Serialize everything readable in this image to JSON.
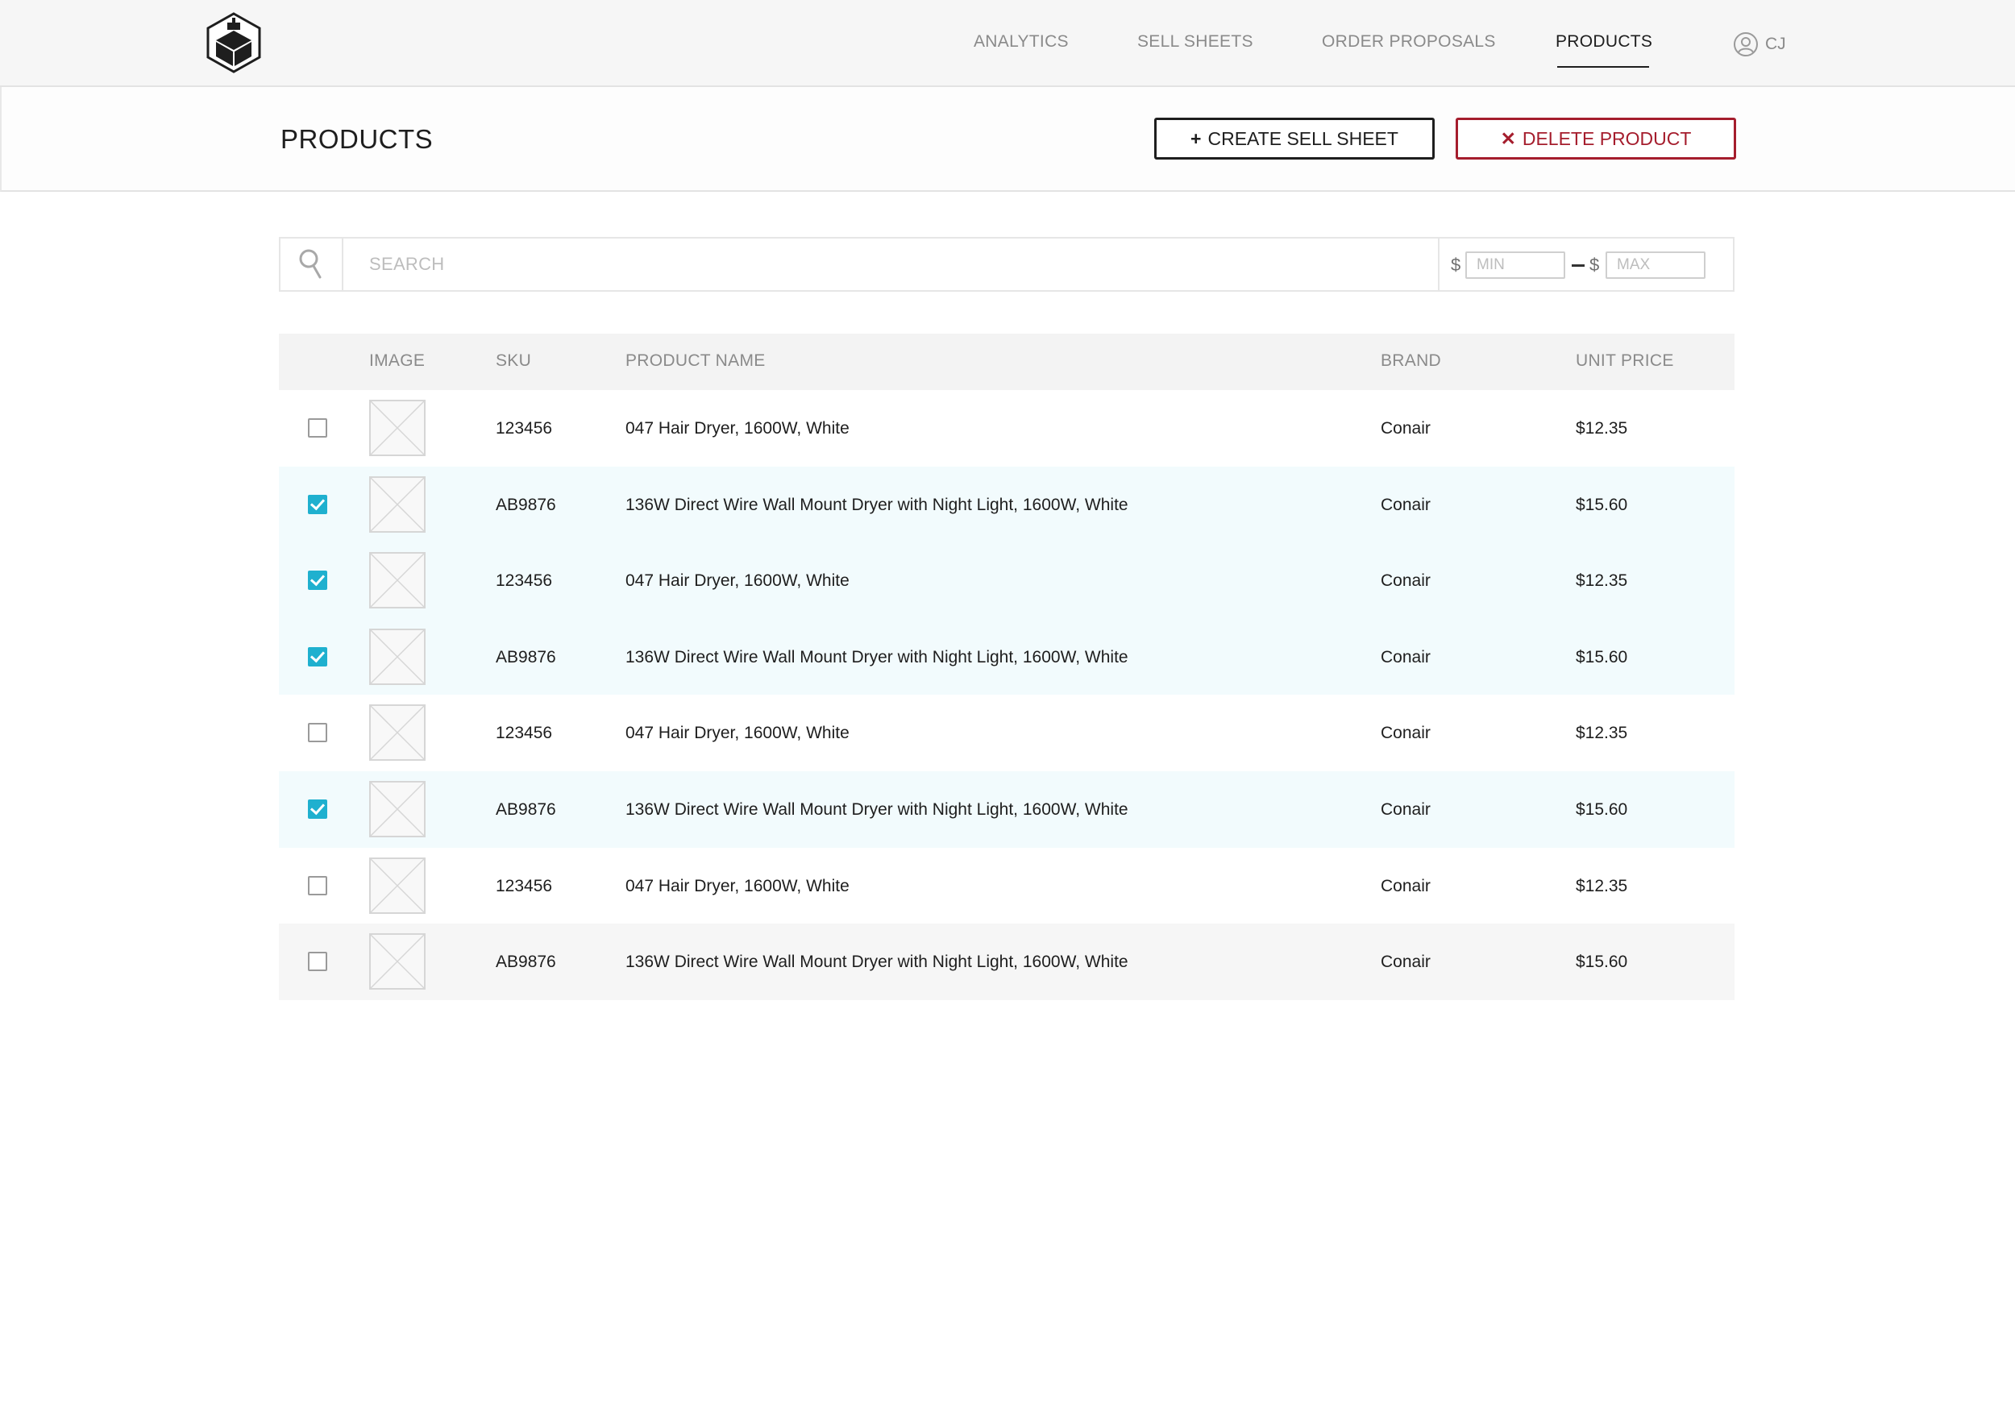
{
  "nav": {
    "items": [
      {
        "label": "ANALYTICS",
        "active": false
      },
      {
        "label": "SELL SHEETS",
        "active": false
      },
      {
        "label": "ORDER PROPOSALS",
        "active": false
      },
      {
        "label": "PRODUCTS",
        "active": true
      }
    ],
    "user_initials": "CJ"
  },
  "page": {
    "title": "PRODUCTS",
    "create_button": {
      "glyph": "+",
      "label": "CREATE SELL SHEET"
    },
    "delete_button": {
      "glyph": "✕",
      "label": "DELETE PRODUCT"
    }
  },
  "search": {
    "placeholder": "SEARCH",
    "currency": "$",
    "min_placeholder": "MIN",
    "max_placeholder": "MAX"
  },
  "table": {
    "columns": {
      "image": "IMAGE",
      "sku": "SKU",
      "name": "PRODUCT NAME",
      "brand": "BRAND",
      "price": "UNIT PRICE"
    },
    "rows": [
      {
        "checked": false,
        "sku": "123456",
        "name": "047 Hair Dryer, 1600W, White",
        "brand": "Conair",
        "price": "$12.35"
      },
      {
        "checked": true,
        "sku": "AB9876",
        "name": "136W Direct Wire Wall Mount Dryer with Night Light, 1600W, White",
        "brand": "Conair",
        "price": "$15.60"
      },
      {
        "checked": true,
        "sku": "123456",
        "name": "047 Hair Dryer, 1600W, White",
        "brand": "Conair",
        "price": "$12.35"
      },
      {
        "checked": true,
        "sku": "AB9876",
        "name": "136W Direct Wire Wall Mount Dryer with Night Light, 1600W, White",
        "brand": "Conair",
        "price": "$15.60"
      },
      {
        "checked": false,
        "sku": "123456",
        "name": "047 Hair Dryer, 1600W, White",
        "brand": "Conair",
        "price": "$12.35"
      },
      {
        "checked": true,
        "sku": "AB9876",
        "name": "136W Direct Wire Wall Mount Dryer with Night Light, 1600W, White",
        "brand": "Conair",
        "price": "$15.60"
      },
      {
        "checked": false,
        "sku": "123456",
        "name": "047 Hair Dryer, 1600W, White",
        "brand": "Conair",
        "price": "$12.35"
      },
      {
        "checked": false,
        "sku": "AB9876",
        "name": "136W Direct Wire Wall Mount Dryer with Night Light, 1600W, White",
        "brand": "Conair",
        "price": "$15.60"
      }
    ]
  },
  "icons": {
    "logo": "hexagon-box-logo-icon",
    "user": "user-circle-icon",
    "search": "search-icon",
    "thumbnail": "image-placeholder-icon"
  },
  "colors": {
    "accent": "#1fb0cf",
    "danger": "#a51d2d",
    "selected_row": "#f2fbfd"
  }
}
